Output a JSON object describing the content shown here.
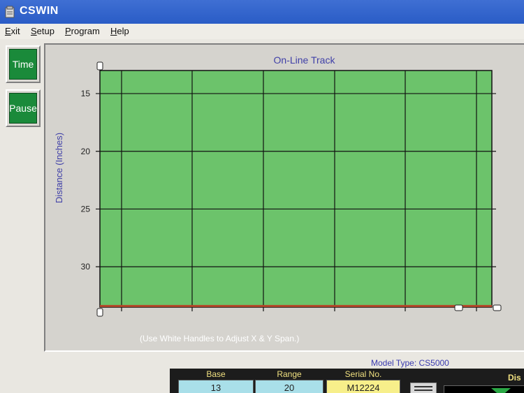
{
  "window": {
    "title": "CSWIN"
  },
  "menu": {
    "exit": {
      "mnemonic": "E",
      "rest": "xit"
    },
    "setup": {
      "mnemonic": "S",
      "rest": "etup"
    },
    "program": {
      "mnemonic": "P",
      "rest": "rogram"
    },
    "help": {
      "mnemonic": "H",
      "rest": "elp"
    }
  },
  "side_buttons": {
    "time": "Time",
    "pause": "Pause"
  },
  "chart_data": {
    "type": "line",
    "title": "On-Line Track",
    "xlabel": "",
    "ylabel": "Distance (Inches)",
    "yticks": [
      "15",
      "20",
      "25",
      "30"
    ],
    "ylim": [
      13,
      33.5
    ],
    "y_inverted": true,
    "x_gridlines": 6,
    "grid": true,
    "series": [
      {
        "values": [
          33.4,
          33.4
        ]
      }
    ],
    "colors": {
      "plot_bg": "#6cc36b",
      "grid": "#111111",
      "title": "#4040a8",
      "line": "#b5482a"
    }
  },
  "hint": "(Use White Handles to Adjust X & Y Span.)",
  "model_type": "Model Type: CS5000",
  "fields": {
    "base": {
      "label": "Base",
      "value": "13"
    },
    "range": {
      "label": "Range",
      "value": "20"
    },
    "serial": {
      "label": "Serial No.",
      "value": "M12224"
    },
    "dist_label": "Dis"
  }
}
